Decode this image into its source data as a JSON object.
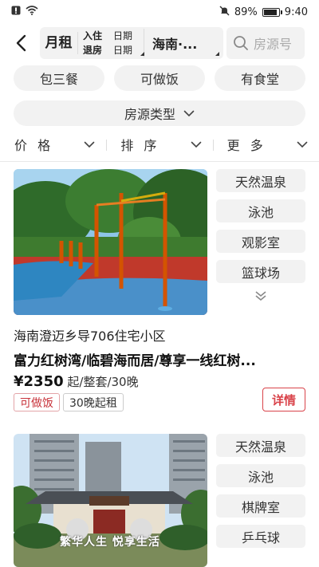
{
  "status": {
    "battery": "89%",
    "time": "9:40",
    "battery_level": 0.89
  },
  "header": {
    "mode": "月租",
    "checkin_label": "入住",
    "checkin_value": "日期",
    "checkout_label": "退房",
    "checkout_value": "日期",
    "city": "海南·...",
    "search_placeholder": "房源号"
  },
  "chips": [
    "包三餐",
    "可做饭",
    "有食堂"
  ],
  "type_filter": "房源类型",
  "sort_bar": [
    "价 格",
    "排 序",
    "更 多"
  ],
  "listings": [
    {
      "amenities": [
        "天然温泉",
        "泳池",
        "观影室",
        "篮球场"
      ],
      "address": "海南澄迈乡导706住宅小区",
      "title": "富力红树湾/临碧海而居/尊享一线红树...",
      "price": "¥2350",
      "price_suffix": " 起/整套/30晚",
      "tags": [
        "可做饭",
        "30晚起租"
      ],
      "detail_label": "详情"
    },
    {
      "amenities": [
        "天然温泉",
        "泳池",
        "棋牌室",
        "乒乓球"
      ],
      "photo_caption": "繁华人生 悦享生活"
    }
  ]
}
